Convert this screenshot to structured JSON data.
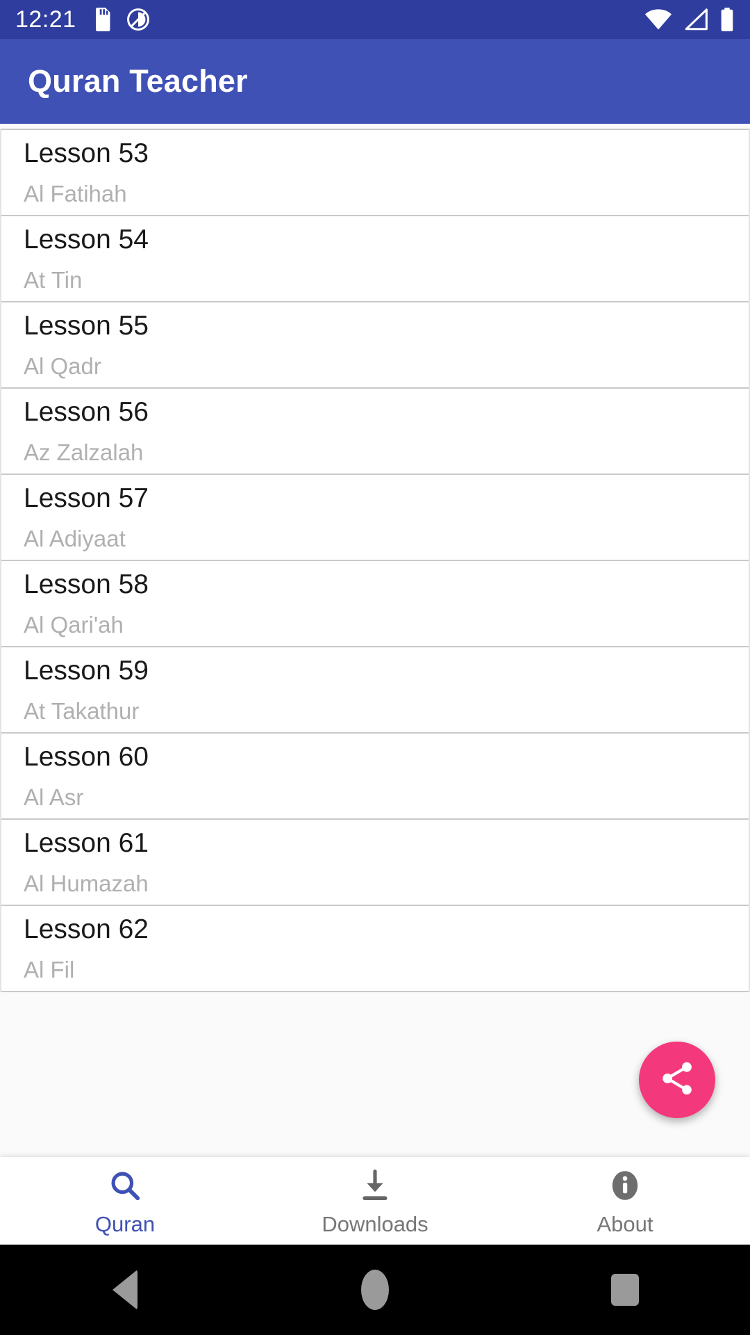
{
  "status_bar": {
    "clock": "12:21",
    "icons_left": [
      "sd-card-icon",
      "do-not-disturb-icon"
    ],
    "icons_right": [
      "wifi-icon",
      "cellular-signal-icon",
      "battery-icon"
    ],
    "background_color": "#2f3d9e",
    "foreground_color": "#ffffff"
  },
  "app_bar": {
    "title": "Quran Teacher",
    "background_color": "#3f51b5",
    "title_color": "#ffffff"
  },
  "lesson_list": {
    "items": [
      {
        "title": "Lesson 53",
        "subtitle": "Al Fatihah"
      },
      {
        "title": "Lesson 54",
        "subtitle": "At Tin"
      },
      {
        "title": "Lesson 55",
        "subtitle": "Al Qadr"
      },
      {
        "title": "Lesson 56",
        "subtitle": "Az Zalzalah"
      },
      {
        "title": "Lesson 57",
        "subtitle": "Al Adiyaat"
      },
      {
        "title": "Lesson 58",
        "subtitle": "Al Qari'ah"
      },
      {
        "title": "Lesson 59",
        "subtitle": "At Takathur"
      },
      {
        "title": "Lesson 60",
        "subtitle": "Al Asr"
      },
      {
        "title": "Lesson 61",
        "subtitle": "Al Humazah"
      },
      {
        "title": "Lesson 62",
        "subtitle": "Al Fil"
      }
    ],
    "title_color": "#1a1a1a",
    "subtitle_color": "#b0b0b0",
    "divider_color": "#c9c9c9"
  },
  "fab": {
    "icon": "share-icon",
    "background_color": "#f4387c",
    "icon_color": "#ffffff"
  },
  "bottom_nav": {
    "items": [
      {
        "label": "Quran",
        "icon": "search-icon",
        "active": true
      },
      {
        "label": "Downloads",
        "icon": "download-icon",
        "active": false
      },
      {
        "label": "About",
        "icon": "info-icon",
        "active": false
      }
    ],
    "active_color": "#3f51b5",
    "inactive_color": "#777777"
  },
  "system_nav": {
    "buttons": [
      "back-button",
      "home-button",
      "recents-button"
    ],
    "background_color": "#000000",
    "icon_color": "#9a9a9a"
  }
}
